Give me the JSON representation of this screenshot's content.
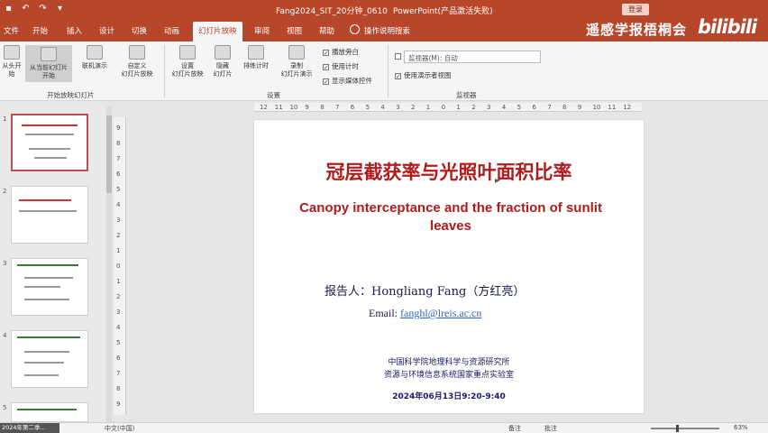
{
  "titlebar": {
    "doc_title": "Fang2024_SIT_20分钟_0610",
    "app_name": "PowerPoint(产品激活失败)",
    "signin": "登录"
  },
  "tabs": [
    "文件",
    "开始",
    "插入",
    "设计",
    "切换",
    "动画",
    "幻灯片放映",
    "审阅",
    "视图",
    "帮助"
  ],
  "tab_search": "操作说明搜索",
  "watermark": "遥感学报梧桐会",
  "bili_logo": "bilibili",
  "ribbon": {
    "buttons": [
      "从头开始",
      "从当前幻灯片开始",
      "联机演示",
      "自定义\n幻灯片放映",
      "设置\n幻灯片放映",
      "隐藏\n幻灯片",
      "排练计时",
      "录制\n幻灯片演示"
    ],
    "checkboxes": [
      "播放旁白",
      "使用计时",
      "显示媒体控件"
    ],
    "monitor_select": "监视器(M): 自动",
    "presenter_view": "使用演示者视图",
    "groups": [
      "开始放映幻灯片",
      "设置",
      "监视器"
    ]
  },
  "thumbnails": [
    "1",
    "2",
    "3",
    "4",
    "5"
  ],
  "ruler_h": [
    "12",
    "11",
    "10",
    "9",
    "8",
    "7",
    "6",
    "5",
    "4",
    "3",
    "2",
    "1",
    "0",
    "1",
    "2",
    "3",
    "4",
    "5",
    "6",
    "7",
    "8",
    "9",
    "10",
    "11",
    "12"
  ],
  "ruler_v": [
    "9",
    "8",
    "7",
    "6",
    "5",
    "4",
    "3",
    "2",
    "1",
    "0",
    "1",
    "2",
    "3",
    "4",
    "5",
    "6",
    "7",
    "8",
    "9"
  ],
  "slide": {
    "title": "冠层截获率与光照叶面积比率",
    "subtitle": "Canopy interceptance and the fraction of sunlit leaves",
    "presenter": "报告人：Hongliang Fang（方红亮）",
    "email_label": "Email: ",
    "email": "fanghl@lreis.ac.cn",
    "institution1": "中国科学院地理科学与资源研究所",
    "institution2": "资源与环境信息系统国家重点实验室",
    "date": "2024年06月13日9:20-9:40"
  },
  "status": {
    "taskbar": "2024年第二季...",
    "language": "中文(中国)",
    "notes": "备注",
    "comments": "批注",
    "zoom": "63%"
  },
  "colors": {
    "accent": "#b7472a",
    "title_red": "#b01c1c",
    "link_blue": "#2f66c8"
  }
}
